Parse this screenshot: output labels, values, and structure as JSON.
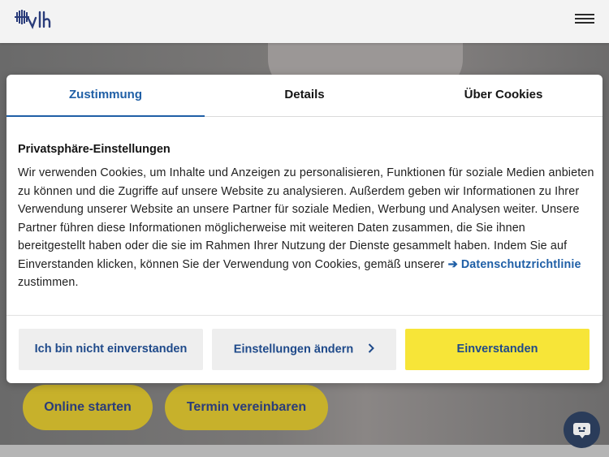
{
  "header": {
    "logo_icon": "vlh-logo-icon",
    "menu_icon": "hamburger-menu-icon"
  },
  "hero": {
    "buttons": [
      "Online starten",
      "Termin vereinbaren"
    ]
  },
  "chat": {
    "icon": "chat-bubble-icon"
  },
  "dialog": {
    "tabs": [
      {
        "label": "Zustimmung",
        "active": true
      },
      {
        "label": "Details",
        "active": false
      },
      {
        "label": "Über Cookies",
        "active": false
      }
    ],
    "heading": "Privatsphäre-Einstellungen",
    "body_text": "Wir verwenden Cookies, um Inhalte und Anzeigen zu personalisieren, Funktionen für soziale Medien anbieten zu können und die Zugriffe auf unsere Website zu analysieren. Außerdem geben wir Informationen zu Ihrer Verwendung unserer Website an unsere Partner für soziale Medien, Werbung und Analysen weiter. Unsere Partner führen diese Informationen möglicherweise mit weiteren Daten zusammen, die Sie ihnen bereitgestellt haben oder die sie im Rahmen Ihrer Nutzung der Dienste gesammelt haben. Indem Sie auf Einverstanden klicken, können Sie der Verwendung von Cookies, gemäß unserer",
    "link_text": "➔ Datenschutzrichtlinie",
    "body_end": "zustimmen.",
    "buttons": {
      "decline": "Ich bin nicht einverstanden",
      "settings": "Einstellungen ändern",
      "accept": "Einverstanden"
    }
  },
  "colors": {
    "accent": "#1f5fa6",
    "accept_button": "#f7e538",
    "chat": "#2a3c5a"
  }
}
